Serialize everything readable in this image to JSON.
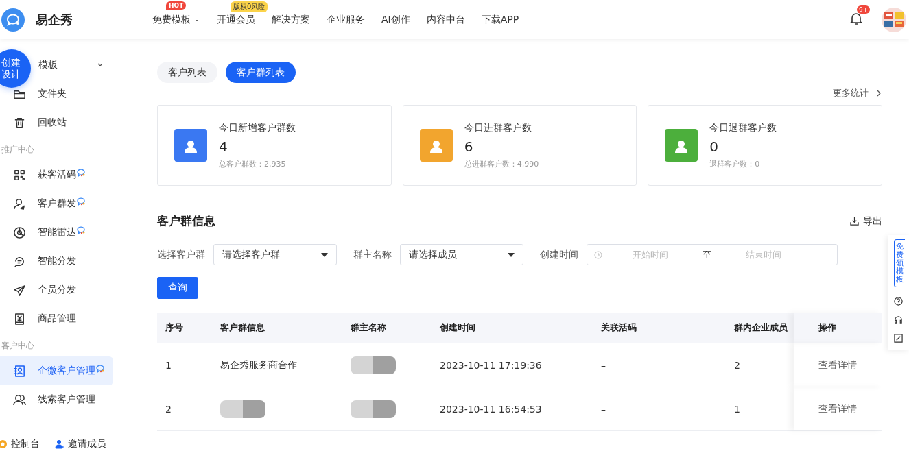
{
  "header": {
    "brand": "易企秀",
    "nav": [
      {
        "label": "免费模板",
        "kind": "hot",
        "badge": "HOT",
        "dropdown": true
      },
      {
        "label": "开通会员",
        "kind": "promo",
        "badge": "版权0风险",
        "dropdown": false
      },
      {
        "label": "解决方案",
        "kind": "plain",
        "dropdown": false
      },
      {
        "label": "企业服务",
        "kind": "plain",
        "dropdown": false
      },
      {
        "label": "AI创作",
        "kind": "plain",
        "dropdown": false
      },
      {
        "label": "内容中台",
        "kind": "plain",
        "dropdown": false
      },
      {
        "label": "下载APP",
        "kind": "plain",
        "dropdown": false
      }
    ],
    "notification_badge": "9+"
  },
  "sidebar": {
    "create_button": "创建设计",
    "items": [
      {
        "kind": "item",
        "label": "模板",
        "expandable": true,
        "new": false,
        "selected": false
      },
      {
        "kind": "item",
        "label": "文件夹",
        "expandable": false,
        "new": false,
        "selected": false
      },
      {
        "kind": "item",
        "label": "回收站",
        "expandable": false,
        "new": false,
        "selected": false
      },
      {
        "kind": "section",
        "label": "推广中心"
      },
      {
        "kind": "item",
        "label": "获客活码",
        "expandable": false,
        "new": true,
        "selected": false
      },
      {
        "kind": "item",
        "label": "客户群发",
        "expandable": false,
        "new": true,
        "selected": false
      },
      {
        "kind": "item",
        "label": "智能雷达",
        "expandable": false,
        "new": true,
        "selected": false
      },
      {
        "kind": "item",
        "label": "智能分发",
        "expandable": false,
        "new": false,
        "selected": false
      },
      {
        "kind": "item",
        "label": "全员分发",
        "expandable": false,
        "new": false,
        "selected": false
      },
      {
        "kind": "item",
        "label": "商品管理",
        "expandable": false,
        "new": false,
        "selected": false
      },
      {
        "kind": "section",
        "label": "客户中心"
      },
      {
        "kind": "item",
        "label": "企微客户管理",
        "expandable": false,
        "new": true,
        "selected": true
      },
      {
        "kind": "item",
        "label": "线索客户管理",
        "expandable": false,
        "new": false,
        "selected": false
      }
    ],
    "footer": [
      "控制台",
      "邀请成员"
    ]
  },
  "tabs": [
    {
      "label": "客户列表",
      "selected": false
    },
    {
      "label": "客户群列表",
      "selected": true
    }
  ],
  "more_stats": "更多统计",
  "stats": [
    {
      "title": "今日新增客户群数",
      "value": "4",
      "sub": "总客户群数：2,935",
      "color": "#3a78f2"
    },
    {
      "title": "今日进群客户数",
      "value": "6",
      "sub": "总进群客户数：4,990",
      "color": "#f2a52e"
    },
    {
      "title": "今日退群客户数",
      "value": "0",
      "sub": "退群客户数：0",
      "color": "#4caf3c"
    }
  ],
  "section_title": "客户群信息",
  "export": "导出",
  "filters": [
    {
      "kind": "select",
      "label": "选择客户群",
      "placeholder": "请选择客户群"
    },
    {
      "kind": "select",
      "label": "群主名称",
      "placeholder": "请选择成员"
    },
    {
      "kind": "daterange",
      "label": "创建时间",
      "start_placeholder": "开始时间",
      "separator": "至",
      "end_placeholder": "结束时间"
    }
  ],
  "query_button": "查询",
  "table": {
    "columns": [
      "序号",
      "客户群信息",
      "群主名称",
      "创建时间",
      "关联活码",
      "群内企业成员",
      "操作"
    ],
    "rows": [
      {
        "cells": [
          {
            "kind": "text",
            "text": "1"
          },
          {
            "kind": "text",
            "text": "易企秀服务商合作"
          },
          {
            "kind": "redacted"
          },
          {
            "kind": "text",
            "text": "2023-10-11 17:19:36"
          },
          {
            "kind": "text",
            "text": "–"
          },
          {
            "kind": "text",
            "text": "2"
          }
        ],
        "action": "查看详情"
      },
      {
        "cells": [
          {
            "kind": "text",
            "text": "2"
          },
          {
            "kind": "redacted"
          },
          {
            "kind": "redacted"
          },
          {
            "kind": "text",
            "text": "2023-10-11 16:54:53"
          },
          {
            "kind": "text",
            "text": "–"
          },
          {
            "kind": "text",
            "text": "1"
          }
        ],
        "action": "查看详情"
      }
    ]
  },
  "side_panel": {
    "label": "免费领模板"
  }
}
